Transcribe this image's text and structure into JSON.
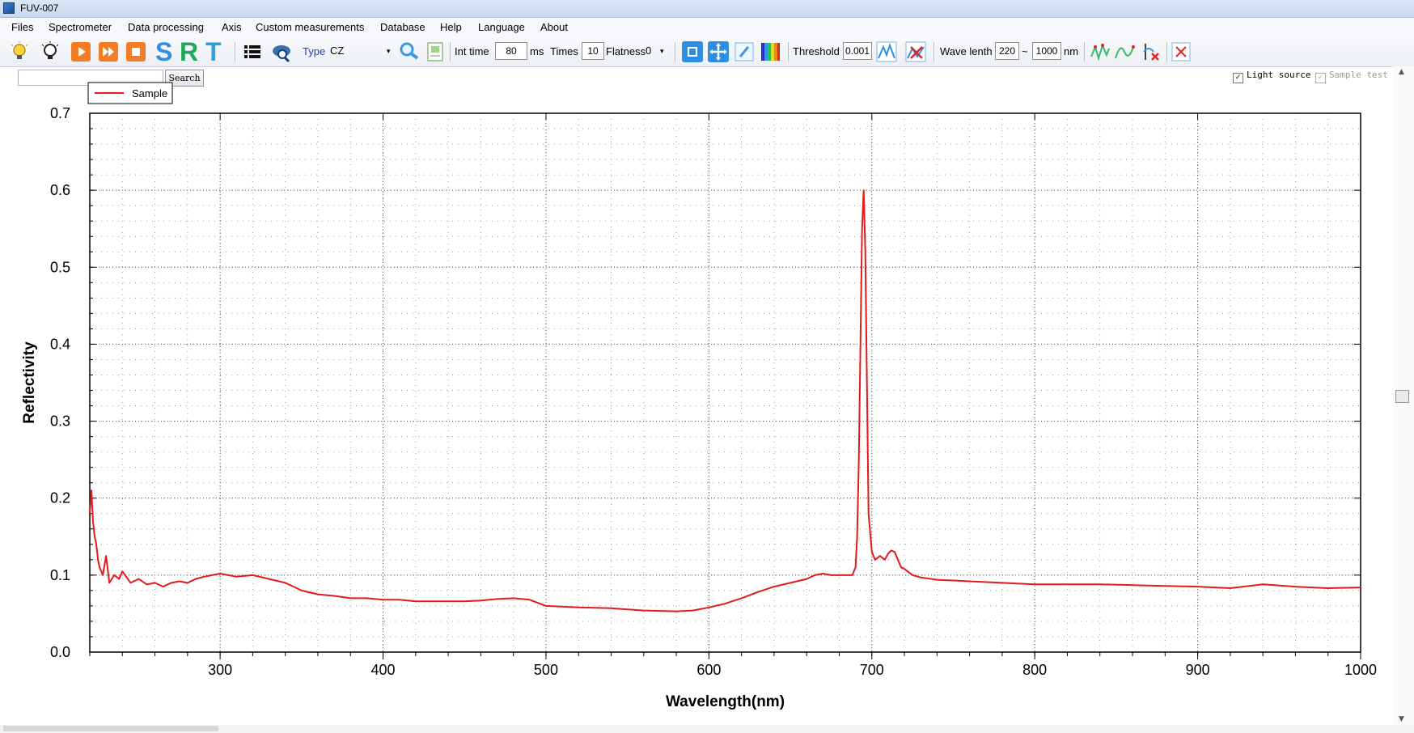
{
  "window": {
    "title": "FUV-007"
  },
  "menu": [
    "Files",
    "Spectrometer",
    "Data processing",
    "Axis",
    "Custom measurements",
    "Database",
    "Help",
    "Language",
    "About"
  ],
  "toolbar": {
    "letters": {
      "s": "S",
      "r": "R",
      "t": "T"
    },
    "type_label": "Type",
    "type_value": "CZ",
    "int_time_label": "Int time",
    "int_time_value": "80",
    "int_time_unit": "ms",
    "times_label": "Times",
    "times_value": "10",
    "flatness_label": "Flatness",
    "flatness_value": "0",
    "threshold_label": "Threshold",
    "threshold_value": "0.001",
    "wavelength_label": "Wave lenth",
    "wavelength_min": "220",
    "wavelength_sep": "~",
    "wavelength_max": "1000",
    "wavelength_unit": "nm",
    "icons": [
      "light-bulb-icon",
      "light-bulb-dark-icon",
      "play-icon",
      "fast-forward-icon",
      "stop-icon",
      "list-icon",
      "cloud-search-icon",
      "magnifier-icon",
      "document-icon",
      "square-icon",
      "move-icon",
      "edit-icon",
      "spectrum-icon",
      "peak-icon",
      "clear-peak-icon",
      "smooth-icon",
      "curve-icon",
      "delete-curve-icon",
      "close-icon"
    ]
  },
  "search": {
    "button_label": "Search"
  },
  "checkboxes": {
    "light_source": {
      "label": "Light source",
      "checked": true
    },
    "sample_test": {
      "label": "Sample test",
      "checked": true,
      "disabled": true
    }
  },
  "chart_data": {
    "type": "line",
    "xlabel": "Wavelength(nm)",
    "ylabel": "Reflectivity",
    "xlim": [
      220,
      1000
    ],
    "ylim": [
      0,
      0.7
    ],
    "xticks": [
      300,
      400,
      500,
      600,
      700,
      800,
      900,
      1000
    ],
    "yticks": [
      0.0,
      0.1,
      0.2,
      0.3,
      0.4,
      0.5,
      0.6,
      0.7
    ],
    "ytick_labels": [
      "0.0",
      "0.1",
      "0.2",
      "0.3",
      "0.4",
      "0.5",
      "0.6",
      "0.7"
    ],
    "grid": true,
    "legend_position": "top-left",
    "series": [
      {
        "name": "Sample",
        "color": "#e31a1c",
        "x": [
          220,
          221,
          222,
          223,
          224,
          225,
          226,
          228,
          230,
          232,
          235,
          238,
          240,
          245,
          250,
          255,
          260,
          265,
          270,
          275,
          280,
          285,
          290,
          295,
          300,
          305,
          310,
          320,
          330,
          340,
          350,
          360,
          370,
          380,
          390,
          400,
          410,
          420,
          430,
          440,
          450,
          460,
          470,
          480,
          490,
          500,
          520,
          540,
          560,
          580,
          590,
          600,
          610,
          620,
          630,
          640,
          650,
          660,
          665,
          670,
          675,
          680,
          685,
          688,
          690,
          691,
          692,
          693,
          694,
          695,
          696,
          697,
          698,
          700,
          702,
          705,
          708,
          710,
          712,
          714,
          716,
          718,
          720,
          725,
          730,
          740,
          750,
          760,
          780,
          800,
          820,
          840,
          860,
          880,
          900,
          920,
          940,
          960,
          980,
          1000
        ],
        "y": [
          0.18,
          0.21,
          0.17,
          0.15,
          0.14,
          0.12,
          0.11,
          0.1,
          0.125,
          0.09,
          0.1,
          0.095,
          0.105,
          0.09,
          0.095,
          0.088,
          0.09,
          0.085,
          0.09,
          0.092,
          0.09,
          0.095,
          0.098,
          0.1,
          0.102,
          0.1,
          0.098,
          0.1,
          0.095,
          0.09,
          0.08,
          0.075,
          0.073,
          0.07,
          0.07,
          0.068,
          0.068,
          0.066,
          0.066,
          0.066,
          0.066,
          0.067,
          0.069,
          0.07,
          0.068,
          0.06,
          0.058,
          0.057,
          0.054,
          0.053,
          0.054,
          0.058,
          0.063,
          0.07,
          0.078,
          0.085,
          0.09,
          0.095,
          0.1,
          0.102,
          0.1,
          0.1,
          0.1,
          0.1,
          0.11,
          0.15,
          0.25,
          0.4,
          0.55,
          0.6,
          0.52,
          0.35,
          0.18,
          0.13,
          0.12,
          0.125,
          0.12,
          0.128,
          0.132,
          0.13,
          0.12,
          0.11,
          0.108,
          0.1,
          0.097,
          0.094,
          0.093,
          0.092,
          0.09,
          0.088,
          0.088,
          0.088,
          0.087,
          0.086,
          0.085,
          0.083,
          0.088,
          0.085,
          0.083,
          0.084
        ]
      }
    ]
  }
}
